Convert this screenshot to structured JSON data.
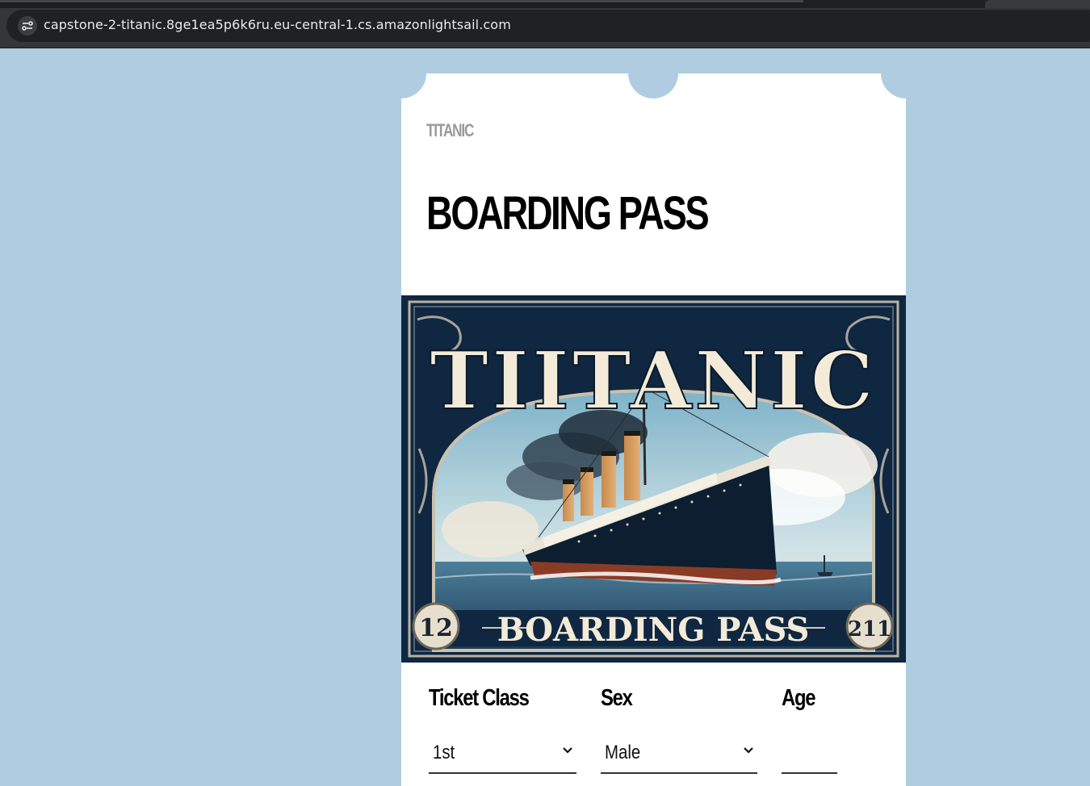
{
  "browser": {
    "url": "capstone-2-titanic.8ge1ea5p6k6ru.eu-central-1.cs.amazonlightsail.com"
  },
  "ticket": {
    "brand": "TITANIC",
    "title": "BOARDING PASS",
    "poster": {
      "heading": "TIITANIC",
      "footer": "BOARDING PASS",
      "left_badge": "12",
      "right_badge": "211"
    }
  },
  "form": {
    "ticket_class": {
      "label": "Ticket Class",
      "value": "1st"
    },
    "sex": {
      "label": "Sex",
      "value": "Male"
    },
    "age": {
      "label": "Age",
      "value": ""
    }
  },
  "colors": {
    "page_bg": "#b0cce0",
    "ticket_bg": "#ffffff",
    "poster_navy": "#0f2740",
    "poster_cream": "#f3ead8"
  }
}
